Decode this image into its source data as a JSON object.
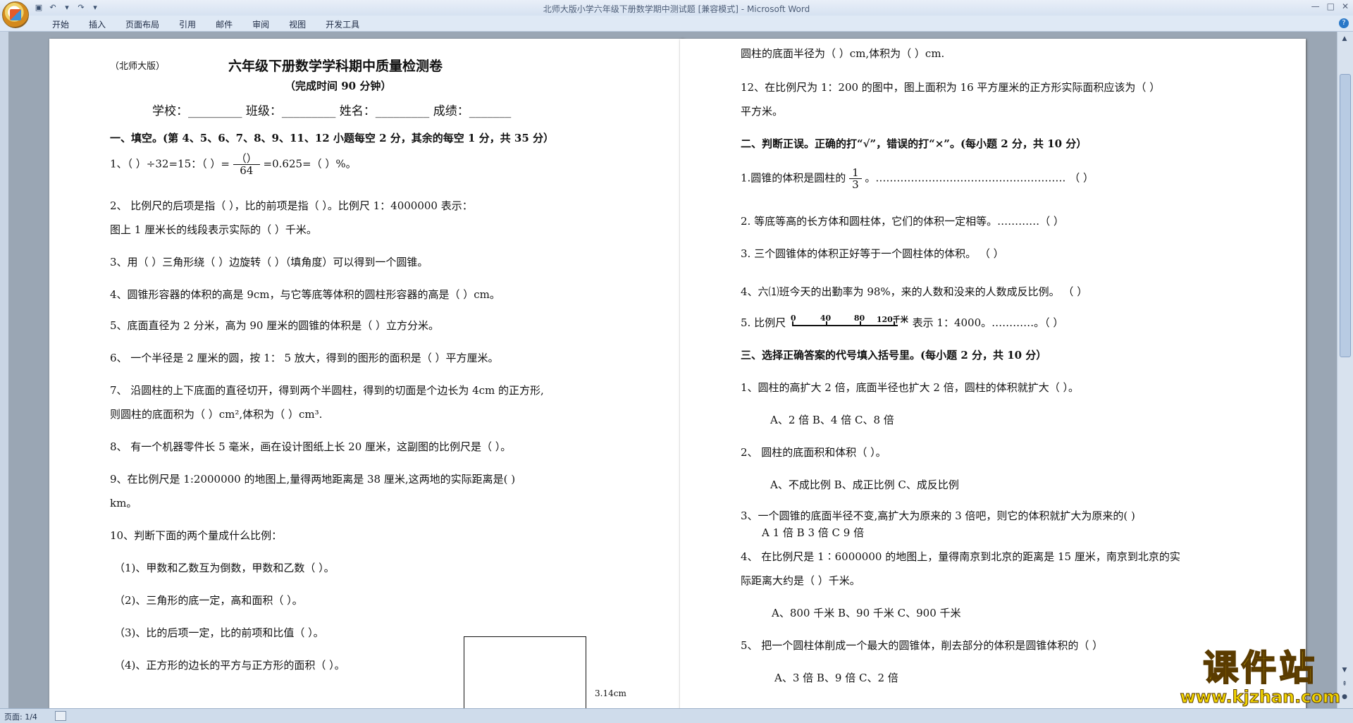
{
  "window": {
    "title": "北师大版小学六年级下册数学期中测试题 [兼容模式]",
    "app_name": "Microsoft Word"
  },
  "ribbon": {
    "tabs": [
      "开始",
      "插入",
      "页面布局",
      "引用",
      "邮件",
      "审阅",
      "视图",
      "开发工具"
    ]
  },
  "status": {
    "page": "页面: 1/4"
  },
  "watermark": {
    "text": "课件站",
    "url": "www.kjzhan.com"
  },
  "page1": {
    "edition": "（北师大版）",
    "title": "六年级下册数学学科期中质量检测卷",
    "subtitle": "（完成时间 90 分钟）",
    "info_line": "学校：_________   班级：_________  姓名：_________  成绩：_______",
    "section1": "一、填空。(第 4、5、6、7、8、9、11、12 小题每空 2 分，其余的每空 1 分，共 35 分）",
    "q1_a": "1、（     ）÷32=15：（     ）=",
    "q1_frac_num": "（）",
    "q1_frac_den": "64",
    "q1_b": "=0.625=（     ）%。",
    "q2_l1": "2、  比例尺的后项是指（          ），比的前项是指（          ）。比例尺 1：4000000 表示：",
    "q2_l2": "图上 1 厘米长的线段表示实际的（        ）千米。",
    "q3": "3、用（      ）三角形绕（     ）边旋转（      ）（填角度）可以得到一个圆锥。",
    "q4": "4、圆锥形容器的体积的高是 9cm，与它等底等体积的圆柱形容器的高是（  ）cm。",
    "q5": "5、底面直径为 2 分米，高为 90 厘米的圆锥的体积是（  ）立方分米。",
    "q6": "6、  一个半径是 2 厘米的圆，按 1：  5 放大，得到的图形的面积是（        ）平方厘米。",
    "q7_l1": "7、  沿圆柱的上下底面的直径切开，得到两个半圆柱，得到的切面是个边长为 4cm 的正方形,",
    "q7_l2": "则圆柱的底面积为（    ）cm²,体积为（    ）cm³.",
    "q8": "8、  有一个机器零件长 5 毫米，画在设计图纸上长 20 厘米，这副图的比例尺是（        ）。",
    "q9_l1": "9、在比例尺是 1:2000000 的地图上,量得两地距离是 38 厘米,这两地的实际距离是(          )",
    "q9_l2": "km。",
    "q10": "10、判断下面的两个量成什么比例：",
    "q10_1": "（1)、甲数和乙数互为倒数，甲数和乙数（          ）。",
    "q10_2": "（2)、三角形的底一定，高和面积（          ）。",
    "q10_3": "（3)、比的后项一定，比的前项和比值（          ）。",
    "q10_4": "（4)、正方形的边长的平方与正方形的面积（          ）。",
    "fig_label": "3.14cm"
  },
  "page2": {
    "top_line": "圆柱的底面半径为（    ）cm,体积为（    ）cm.",
    "q12_l1": "12、在比例尺为 1：200 的图中，图上面积为 16 平方厘米的正方形实际面积应该为（        ）",
    "q12_l2": "平方米。",
    "section2": "二、判断正误。正确的打“√”，错误的打“×”。(每小题 2 分，共 10 分）",
    "j1_a": "1.圆锥的体积是圆柱的",
    "j1_num": "1",
    "j1_den": "3",
    "j1_b": "。………………………………………………  （     ）",
    "j2": "2.  等底等高的长方体和圆柱体，它们的体积一定相等。…………（     ）",
    "j3": "3.  三个圆锥体的体积正好等于一个圆柱体的体积。  （     ）",
    "j4": "4、六⑴班今天的出勤率为 98%，来的人数和没来的人数成反比例。       （     ）",
    "j5_a": "5.  比例尺",
    "j5_scale": [
      "0",
      "40",
      "80",
      "120千米"
    ],
    "j5_b": "表示 1：4000。…………。（     ）",
    "section3": "三、选择正确答案的代号填入括号里。(每小题 2 分，共 10 分）",
    "c1": "1、圆柱的高扩大 2 倍，底面半径也扩大 2 倍，圆柱的体积就扩大（     ）。",
    "c1_opts": "A、2 倍            B、4 倍          C、8 倍",
    "c2": "2、  圆柱的底面积和体积（      ）。",
    "c2_opts": "A、不成比例       B、成正比例       C、成反比例",
    "c3": "3、一个圆锥的底面半径不变,高扩大为原来的 3 倍吧，则它的体积就扩大为原来的(          )",
    "c3_opts": "A    1 倍           B   3 倍            C   9 倍",
    "c4_l1": "4、  在比例尺是 1∶6000000 的地图上，量得南京到北京的距离是 15 厘米，南京到北京的实",
    "c4_l2": "际距离大约是（   ）千米。",
    "c4_opts": "A、800 千米         B、90 千米          C、900 千米",
    "c5": "5、  把一个圆柱体削成一个最大的圆锥体，削去部分的体积是圆锥体积的（        ）",
    "c5_opts": "A、3 倍                B、9 倍                C、2 倍"
  }
}
